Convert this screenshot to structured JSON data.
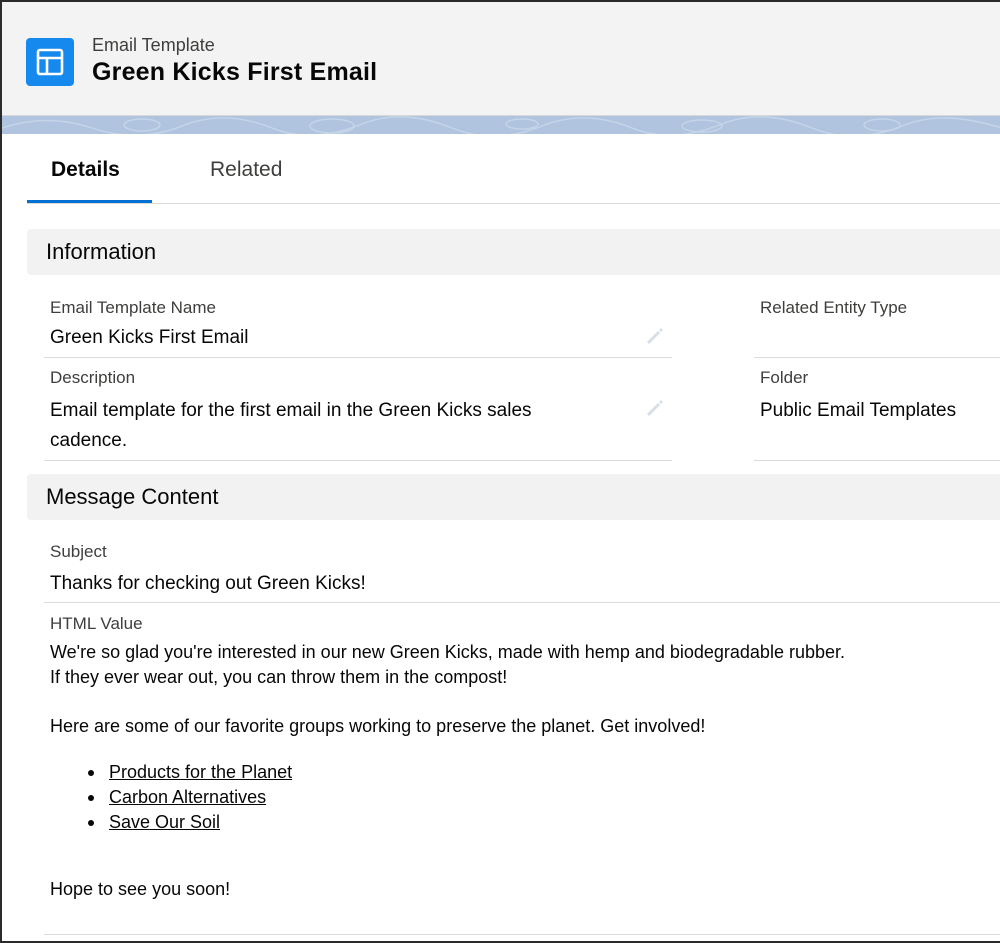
{
  "header": {
    "object_type": "Email Template",
    "record_title": "Green Kicks First Email",
    "icon": "template-layout-icon",
    "icon_color": "#1589ee"
  },
  "tabs": [
    {
      "label": "Details",
      "active": true
    },
    {
      "label": "Related",
      "active": false
    }
  ],
  "sections": {
    "information": {
      "title": "Information",
      "fields": {
        "template_name": {
          "label": "Email Template Name",
          "value": "Green Kicks First Email"
        },
        "related_entity_type": {
          "label": "Related Entity Type",
          "value": ""
        },
        "description": {
          "label": "Description",
          "value_line1": "Email template for the first email in the Green Kicks sales",
          "value_line2": "cadence."
        },
        "folder": {
          "label": "Folder",
          "value": "Public Email Templates"
        }
      }
    },
    "message_content": {
      "title": "Message Content",
      "subject": {
        "label": "Subject",
        "value": "Thanks for checking out Green Kicks!"
      },
      "html_value": {
        "label": "HTML Value",
        "paragraph1_line1": "We're so glad you're interested in our new Green Kicks, made with hemp and biodegradable rubber.",
        "paragraph1_line2": "If they ever wear out, you can throw them in the compost!",
        "paragraph2": "Here are some of our favorite groups working to preserve the planet. Get involved!",
        "links": [
          "Products for the Planet",
          "Carbon Alternatives",
          "Save Our Soil"
        ],
        "closing": "Hope to see you soon!"
      }
    }
  },
  "colors": {
    "accent": "#0070d2",
    "header_band": "#b0c4df",
    "section_bg": "#f3f2f2"
  }
}
